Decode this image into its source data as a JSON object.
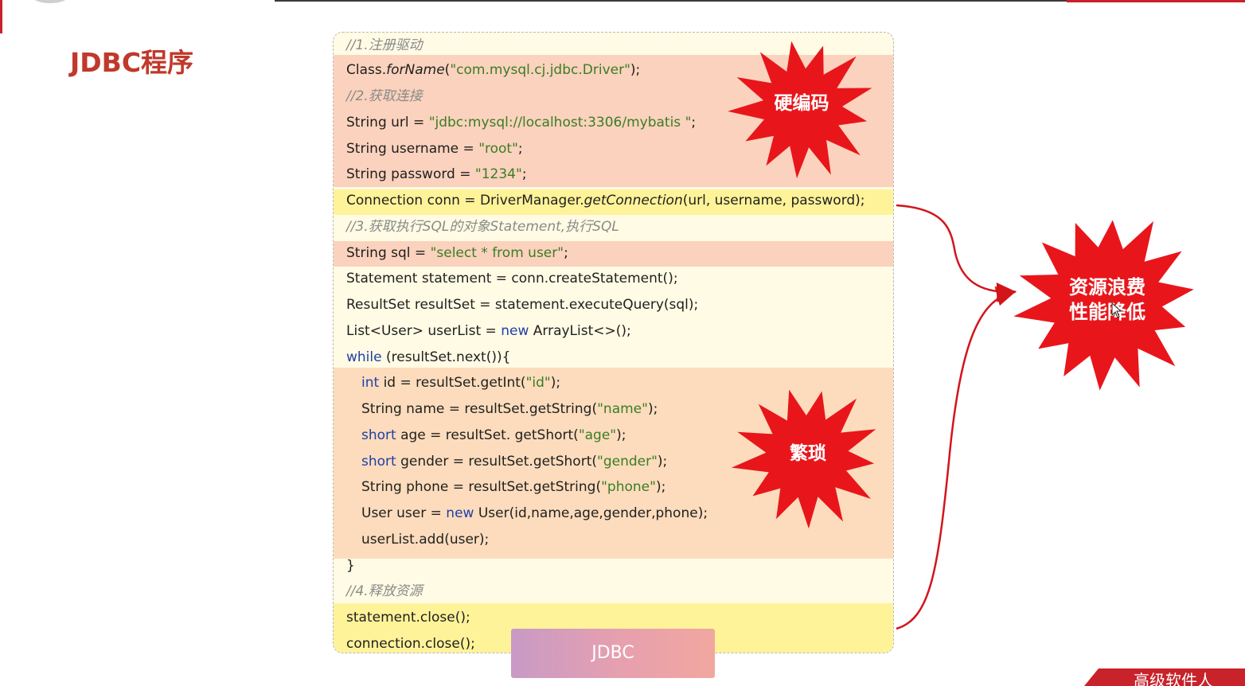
{
  "page": {
    "title": "JDBC程序"
  },
  "code": {
    "c1": "//1.注册驱动",
    "l1": {
      "a": "Class.",
      "b": "forName",
      "c": "(",
      "d": "\"com.mysql.cj.jdbc.Driver\"",
      "e": ");"
    },
    "c2": "//2.获取连接",
    "l2": {
      "a": "String url = ",
      "b": "\"jdbc:mysql://localhost:3306/mybatis \"",
      "c": ";"
    },
    "l3": {
      "a": "String username = ",
      "b": "\"root\"",
      "c": ";"
    },
    "l4": {
      "a": "String password = ",
      "b": "\"1234\"",
      "c": ";"
    },
    "l5": {
      "a": "Connection conn = DriverManager.",
      "b": "getConnection",
      "c": "(url, username, password);"
    },
    "c3": "//3.获取执行SQL的对象Statement,执行SQL",
    "l6": {
      "a": "String sql = ",
      "b": "\"select * from user\"",
      "c": ";"
    },
    "l7": "Statement statement = conn.createStatement();",
    "l8": "ResultSet resultSet = statement.executeQuery(sql);",
    "l9": {
      "a": "List<User> userList = ",
      "kw": "new",
      "c": " ArrayList<>();"
    },
    "l10": {
      "kw": "while",
      "c": " (resultSet.next()){"
    },
    "l11": {
      "kw": "int",
      "a": " id = resultSet.getInt(",
      "s": "\"id\"",
      "c": ");"
    },
    "l12": {
      "a": "String name = resultSet.getString(",
      "s": "\"name\"",
      "c": ");"
    },
    "l13": {
      "kw": "short",
      "a": " age = resultSet. getShort(",
      "s": "\"age\"",
      "c": ");"
    },
    "l14": {
      "kw": "short",
      "a": " gender = resultSet.getShort(",
      "s": "\"gender\"",
      "c": ");"
    },
    "l15": {
      "a": "String phone = resultSet.getString(",
      "s": "\"phone\"",
      "c": ");"
    },
    "l16": {
      "a": "User user = ",
      "kw": "new",
      "c": " User(id,name,age,gender,phone);"
    },
    "l17": "userList.add(user);",
    "l18": "}",
    "c4": "//4.释放资源",
    "l19": "statement.close();",
    "l20": "connection.close();"
  },
  "badges": {
    "hardcode": "硬编码",
    "tedious": "繁琐",
    "waste_line1": "资源浪费",
    "waste_line2": "性能降低"
  },
  "bottom_tab": {
    "label": "JDBC"
  },
  "corner_banner": {
    "text": "高级软件人"
  },
  "colors": {
    "title_red": "#c0392b",
    "highlight_red": "#fbd2bd",
    "highlight_yellow": "#fff399",
    "highlight_orange": "#fcdcbc",
    "panel_bg": "#fffbe4",
    "burst_red": "#e8161b",
    "keyword_blue": "#1f3fa8",
    "string_green": "#3a7d25"
  }
}
